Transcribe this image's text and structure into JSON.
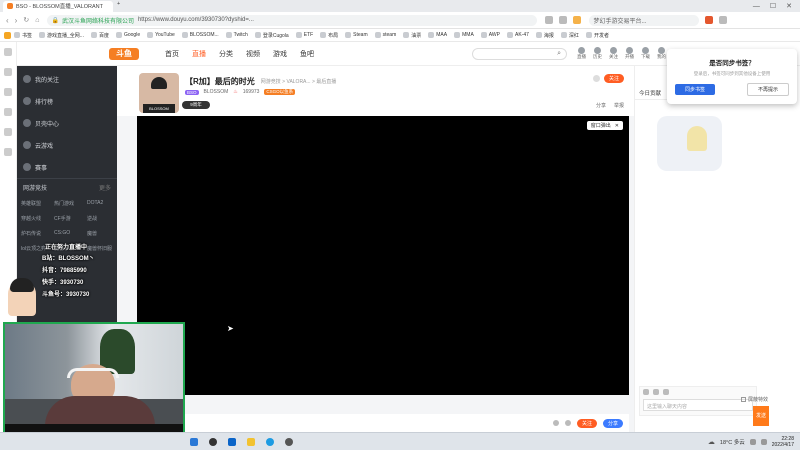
{
  "browser": {
    "tabs": [
      {
        "label": "BSO - BLOSSOM直播_VALORANT"
      },
      {
        "label": "+"
      }
    ],
    "address": {
      "site_label": "武汉斗鱼网络科技有限公司",
      "url": "https://www.douyu.com/3930730?dyshid=...",
      "icons": [
        "home-icon",
        "lock-icon"
      ]
    },
    "window_controls": [
      "minimize-icon",
      "maximize-icon",
      "close-icon"
    ],
    "right_tab": "梦幻手游交易平台...",
    "bookmarks": [
      "书签",
      "游戏直播_全网...",
      "百度",
      "Google",
      "YouTube",
      "BLOSSOM...",
      "Twitch",
      "登录Cugola",
      "ETF",
      "布局",
      "Steam",
      "steam",
      "油票",
      "MAA",
      "MMA",
      "AWP",
      "AK-47",
      "海报",
      "深红",
      "开发者"
    ]
  },
  "site": {
    "logo": "斗鱼",
    "nav": [
      "首页",
      "直播",
      "分类",
      "视频",
      "游戏",
      "鱼吧"
    ],
    "active_nav": "直播",
    "search_placeholder": "",
    "header_icons": [
      {
        "name": "live-icon",
        "label": "直播"
      },
      {
        "name": "history-icon",
        "label": "历史"
      },
      {
        "name": "follow-icon",
        "label": "关注"
      },
      {
        "name": "open-live-icon",
        "label": "开播"
      },
      {
        "name": "download-icon",
        "label": "下载"
      },
      {
        "name": "user-icon",
        "label": "我的"
      }
    ]
  },
  "sidebar": {
    "items": [
      "我的关注",
      "排行榜",
      "贝壳中心",
      "云游戏",
      "赛事"
    ],
    "section_title": "网游竞技",
    "section_more": "更多",
    "grid": [
      "英雄联盟",
      "热门游戏",
      "DOTA2",
      "穿越火线",
      "CF手游",
      "逆战",
      "炉石传说",
      "CS:GO",
      "魔兽",
      "lol云顶之弈",
      "魔兽争霸",
      "魔兽怀旧服"
    ]
  },
  "streamer": {
    "title": "【R加】最后的时光",
    "category_path": "网游竞技 > VALORA... > 最后直播",
    "name": "BLOSSOM",
    "level": "BSO",
    "heat": "169973",
    "tag_live": "CSGO以鱼系",
    "follow_label": "关注",
    "share_label": "分享",
    "report_label": "举报",
    "popout_label": "窗口弹出",
    "rank_tab": "今日贡献",
    "cam_overlay": [
      "B站：BLOSSOM丶",
      "抖音：79885990",
      "快手：3930730",
      "斗鱼号：3930730"
    ],
    "cam_header": "正在努力直播中"
  },
  "rightpanel": {
    "dialog_title": "是否同步书签？",
    "dialog_body": "登录后，书签可同步到其他设备上使用",
    "sync_button": "同步书签",
    "cancel_button": "不再提示",
    "chat_placeholder": "这里输入聊天内容",
    "send_button": "发送",
    "shield_label": "屏蔽特效"
  },
  "controls": {
    "btn1": "关注",
    "btn2": "分享"
  },
  "taskbar": {
    "weather": "18°C 多云",
    "time": "22:28",
    "date": "2022/4/17"
  }
}
